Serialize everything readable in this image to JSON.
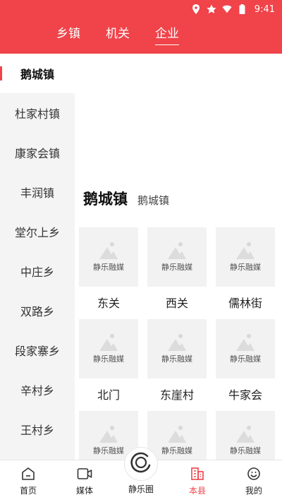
{
  "status_bar": {
    "time": "9:41",
    "icons": [
      "location-icon",
      "star-icon",
      "wifi-icon",
      "battery-icon"
    ]
  },
  "top_tabs": [
    {
      "label": "乡镇",
      "active": false
    },
    {
      "label": "机关",
      "active": false
    },
    {
      "label": "企业",
      "active": true
    }
  ],
  "sidebar": {
    "items": [
      {
        "label": "鹅城镇",
        "active": true
      },
      {
        "label": "杜家村镇"
      },
      {
        "label": "康家会镇"
      },
      {
        "label": "丰润镇"
      },
      {
        "label": "堂尔上乡"
      },
      {
        "label": "中庄乡"
      },
      {
        "label": "双路乡"
      },
      {
        "label": "段家寨乡"
      },
      {
        "label": "辛村乡"
      },
      {
        "label": "王村乡"
      }
    ]
  },
  "main": {
    "title": "鹅城镇",
    "subtitle": "鹅城镇",
    "placeholder_text": "静乐融媒",
    "cards": [
      {
        "name": "东关"
      },
      {
        "name": "西关"
      },
      {
        "name": "儒林街"
      },
      {
        "name": "北门"
      },
      {
        "name": "东崖村"
      },
      {
        "name": "牛家会"
      },
      {
        "name": ""
      },
      {
        "name": ""
      },
      {
        "name": ""
      }
    ]
  },
  "bottom_nav": {
    "items": [
      {
        "label": "首页",
        "icon": "home-icon"
      },
      {
        "label": "媒体",
        "icon": "video-icon"
      },
      {
        "label": "本县",
        "icon": "building-icon",
        "active": true
      },
      {
        "label": "我的",
        "icon": "user-icon"
      }
    ],
    "center": {
      "label": "静乐圈",
      "icon": "circle-logo-icon"
    }
  },
  "colors": {
    "brand_red": "#f0434a",
    "sidebar_bg": "#f4f4f4",
    "placeholder_bg": "#f2f2f2"
  }
}
